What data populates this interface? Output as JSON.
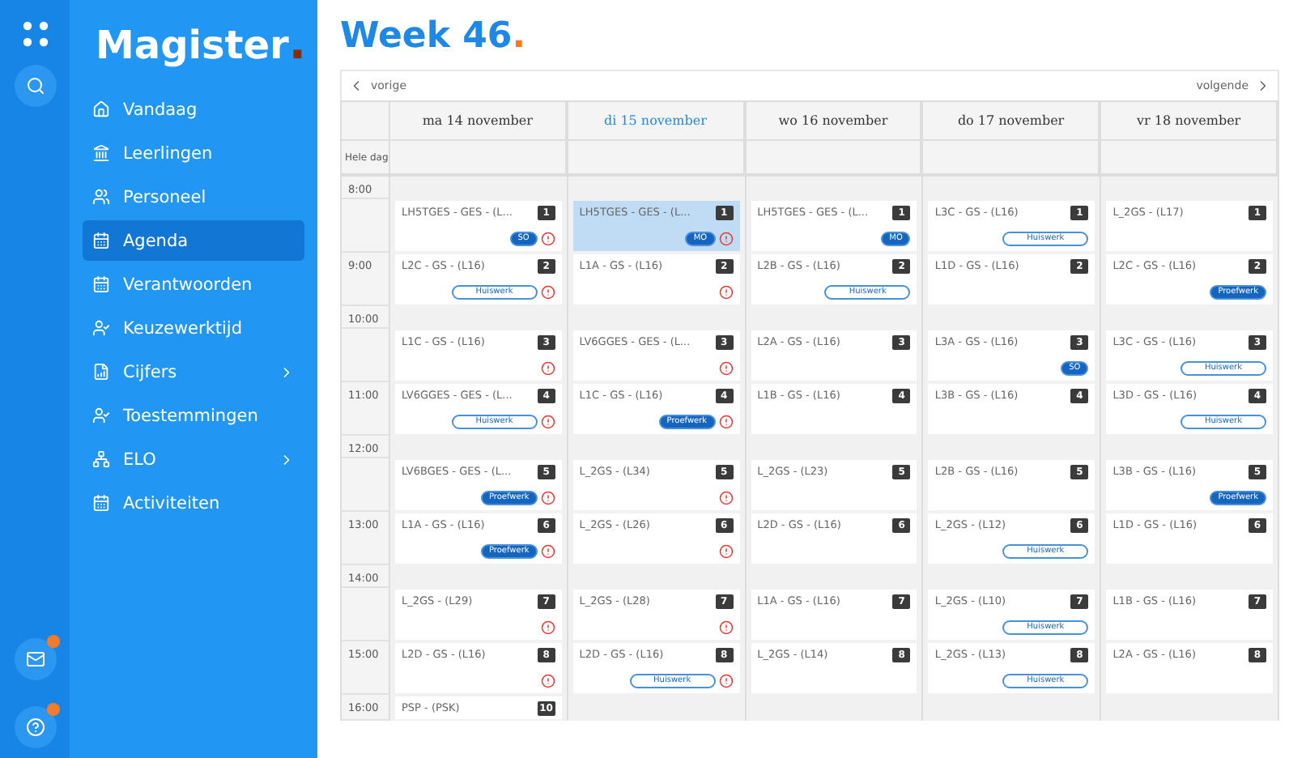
{
  "rail": {
    "buttons": [
      {
        "kind": "apps"
      },
      {
        "kind": "search"
      }
    ],
    "bottom": [
      {
        "kind": "mail",
        "dot": true
      },
      {
        "kind": "help",
        "dot": true
      }
    ]
  },
  "sidebar": {
    "logo": "Magister",
    "logo_mark": ".",
    "items": [
      {
        "label": "Vandaag",
        "selected": false,
        "submenu": false
      },
      {
        "label": "Leerlingen",
        "selected": false,
        "submenu": false
      },
      {
        "label": "Personeel",
        "selected": false,
        "submenu": false
      },
      {
        "label": "Agenda",
        "selected": true,
        "submenu": false
      },
      {
        "label": "Verantwoorden",
        "selected": false,
        "submenu": false
      },
      {
        "label": "Keuzewerktijd",
        "selected": false,
        "submenu": false
      },
      {
        "label": "Cijfers",
        "selected": false,
        "submenu": true
      },
      {
        "label": "Toestemmingen",
        "selected": false,
        "submenu": false
      },
      {
        "label": "ELO",
        "selected": false,
        "submenu": true
      },
      {
        "label": "Activiteiten",
        "selected": false,
        "submenu": false
      }
    ]
  },
  "page": {
    "title": "Week 46",
    "title_mark": "."
  },
  "nav": {
    "previous": "vorige",
    "next": "volgende"
  },
  "allday_label": "Hele dag",
  "time_rows": [
    {
      "kind": "break",
      "time": "8:00"
    },
    {
      "kind": "lesson"
    },
    {
      "kind": "lesson",
      "time": "9:00"
    },
    {
      "kind": "break",
      "time": "10:00"
    },
    {
      "kind": "lesson"
    },
    {
      "kind": "lesson",
      "time": "11:00"
    },
    {
      "kind": "break",
      "time": "12:00"
    },
    {
      "kind": "lesson"
    },
    {
      "kind": "lesson",
      "time": "13:00"
    },
    {
      "kind": "break",
      "time": "14:00"
    },
    {
      "kind": "lesson"
    },
    {
      "kind": "lesson",
      "time": "15:00"
    },
    {
      "kind": "lesson",
      "time": "16:00"
    }
  ],
  "days": [
    {
      "label": "ma 14 november",
      "today": false,
      "lessons": [
        {
          "kind": "lesson",
          "title": "LH5TGES - GES - (L...",
          "hour": "1",
          "badge": {
            "kind": "filled",
            "text": "SO"
          },
          "alert": true,
          "selected": false
        },
        {
          "kind": "lesson",
          "title": "L2C - GS - (L16)",
          "hour": "2",
          "badge": {
            "kind": "outline",
            "text": "Huiswerk"
          },
          "alert": true,
          "selected": false
        },
        {
          "kind": "lesson",
          "title": "L1C - GS - (L16)",
          "hour": "3",
          "alert": true,
          "selected": false
        },
        {
          "kind": "lesson",
          "title": "LV6GGES - GES - (L...",
          "hour": "4",
          "badge": {
            "kind": "outline",
            "text": "Huiswerk"
          },
          "alert": true,
          "selected": false
        },
        {
          "kind": "lesson",
          "title": "LV6BGES - GES - (L...",
          "hour": "5",
          "badge": {
            "kind": "filled",
            "text": "Proefwerk"
          },
          "alert": true,
          "selected": false
        },
        {
          "kind": "lesson",
          "title": "L1A - GS - (L16)",
          "hour": "6",
          "badge": {
            "kind": "filled",
            "text": "Proefwerk"
          },
          "alert": true,
          "selected": false
        },
        {
          "kind": "lesson",
          "title": "L_2GS - (L29)",
          "hour": "7",
          "alert": true,
          "selected": false
        },
        {
          "kind": "lesson",
          "title": "L2D - GS - (L16)",
          "hour": "8",
          "alert": true,
          "selected": false
        },
        {
          "kind": "lesson",
          "title": "PSP - (PSK)",
          "hour": "10",
          "selected": false
        }
      ]
    },
    {
      "label": "di 15 november",
      "today": true,
      "lessons": [
        {
          "kind": "lesson",
          "title": "LH5TGES - GES - (L...",
          "hour": "1",
          "badge": {
            "kind": "filled",
            "text": "MO"
          },
          "alert": true,
          "selected": true
        },
        {
          "kind": "lesson",
          "title": "L1A - GS - (L16)",
          "hour": "2",
          "alert": true,
          "selected": false
        },
        {
          "kind": "lesson",
          "title": "LV6GGES - GES - (L...",
          "hour": "3",
          "alert": true,
          "selected": false
        },
        {
          "kind": "lesson",
          "title": "L1C - GS - (L16)",
          "hour": "4",
          "badge": {
            "kind": "filled",
            "text": "Proefwerk"
          },
          "alert": true,
          "selected": false
        },
        {
          "kind": "lesson",
          "title": "L_2GS - (L34)",
          "hour": "5",
          "alert": true,
          "selected": false
        },
        {
          "kind": "lesson",
          "title": "L_2GS - (L26)",
          "hour": "6",
          "alert": true,
          "selected": false
        },
        {
          "kind": "lesson",
          "title": "L_2GS - (L28)",
          "hour": "7",
          "alert": true,
          "selected": false
        },
        {
          "kind": "lesson",
          "title": "L2D - GS - (L16)",
          "hour": "8",
          "badge": {
            "kind": "outline",
            "text": "Huiswerk"
          },
          "alert": true,
          "selected": false
        },
        {
          "kind": "free"
        }
      ]
    },
    {
      "label": "wo 16 november",
      "today": false,
      "lessons": [
        {
          "kind": "lesson",
          "title": "LH5TGES - GES - (L...",
          "hour": "1",
          "badge": {
            "kind": "filled",
            "text": "MO"
          },
          "alert": false,
          "selected": false
        },
        {
          "kind": "lesson",
          "title": "L2B - GS - (L16)",
          "hour": "2",
          "badge": {
            "kind": "outline",
            "text": "Huiswerk"
          },
          "alert": false,
          "selected": false
        },
        {
          "kind": "lesson",
          "title": "L2A - GS - (L16)",
          "hour": "3",
          "alert": false,
          "selected": false
        },
        {
          "kind": "lesson",
          "title": "L1B - GS - (L16)",
          "hour": "4",
          "alert": false,
          "selected": false
        },
        {
          "kind": "lesson",
          "title": "L_2GS - (L23)",
          "hour": "5",
          "alert": false,
          "selected": false
        },
        {
          "kind": "lesson",
          "title": "L2D - GS - (L16)",
          "hour": "6",
          "alert": false,
          "selected": false
        },
        {
          "kind": "lesson",
          "title": "L1A - GS - (L16)",
          "hour": "7",
          "alert": false,
          "selected": false
        },
        {
          "kind": "lesson",
          "title": "L_2GS - (L14)",
          "hour": "8",
          "alert": false,
          "selected": false
        },
        {
          "kind": "free"
        }
      ]
    },
    {
      "label": "do 17 november",
      "today": false,
      "lessons": [
        {
          "kind": "lesson",
          "title": "L3C - GS - (L16)",
          "hour": "1",
          "badge": {
            "kind": "outline",
            "text": "Huiswerk"
          },
          "alert": false,
          "selected": false
        },
        {
          "kind": "lesson",
          "title": "L1D - GS - (L16)",
          "hour": "2",
          "alert": false,
          "selected": false
        },
        {
          "kind": "lesson",
          "title": "L3A - GS - (L16)",
          "hour": "3",
          "badge": {
            "kind": "filled",
            "text": "SO"
          },
          "alert": false,
          "selected": false
        },
        {
          "kind": "lesson",
          "title": "L3B - GS - (L16)",
          "hour": "4",
          "alert": false,
          "selected": false
        },
        {
          "kind": "lesson",
          "title": "L2B - GS - (L16)",
          "hour": "5",
          "alert": false,
          "selected": false
        },
        {
          "kind": "lesson",
          "title": "L_2GS - (L12)",
          "hour": "6",
          "badge": {
            "kind": "outline",
            "text": "Huiswerk"
          },
          "alert": false,
          "selected": false
        },
        {
          "kind": "lesson",
          "title": "L_2GS - (L10)",
          "hour": "7",
          "badge": {
            "kind": "outline",
            "text": "Huiswerk"
          },
          "alert": false,
          "selected": false
        },
        {
          "kind": "lesson",
          "title": "L_2GS - (L13)",
          "hour": "8",
          "badge": {
            "kind": "outline",
            "text": "Huiswerk"
          },
          "alert": false,
          "selected": false
        },
        {
          "kind": "free"
        }
      ]
    },
    {
      "label": "vr 18 november",
      "today": false,
      "lessons": [
        {
          "kind": "lesson",
          "title": "L_2GS - (L17)",
          "hour": "1",
          "alert": false,
          "selected": false
        },
        {
          "kind": "lesson",
          "title": "L2C - GS - (L16)",
          "hour": "2",
          "badge": {
            "kind": "filled",
            "text": "Proefwerk"
          },
          "alert": false,
          "selected": false
        },
        {
          "kind": "lesson",
          "title": "L3C - GS - (L16)",
          "hour": "3",
          "badge": {
            "kind": "outline",
            "text": "Huiswerk"
          },
          "alert": false,
          "selected": false
        },
        {
          "kind": "lesson",
          "title": "L3D - GS - (L16)",
          "hour": "4",
          "badge": {
            "kind": "outline",
            "text": "Huiswerk"
          },
          "alert": false,
          "selected": false
        },
        {
          "kind": "lesson",
          "title": "L3B - GS - (L16)",
          "hour": "5",
          "badge": {
            "kind": "filled",
            "text": "Proefwerk"
          },
          "alert": false,
          "selected": false
        },
        {
          "kind": "lesson",
          "title": "L1D - GS - (L16)",
          "hour": "6",
          "alert": false,
          "selected": false
        },
        {
          "kind": "lesson",
          "title": "L1B - GS - (L16)",
          "hour": "7",
          "alert": false,
          "selected": false
        },
        {
          "kind": "lesson",
          "title": "L2A - GS - (L16)",
          "hour": "8",
          "alert": false,
          "selected": false
        },
        {
          "kind": "free"
        }
      ]
    }
  ]
}
